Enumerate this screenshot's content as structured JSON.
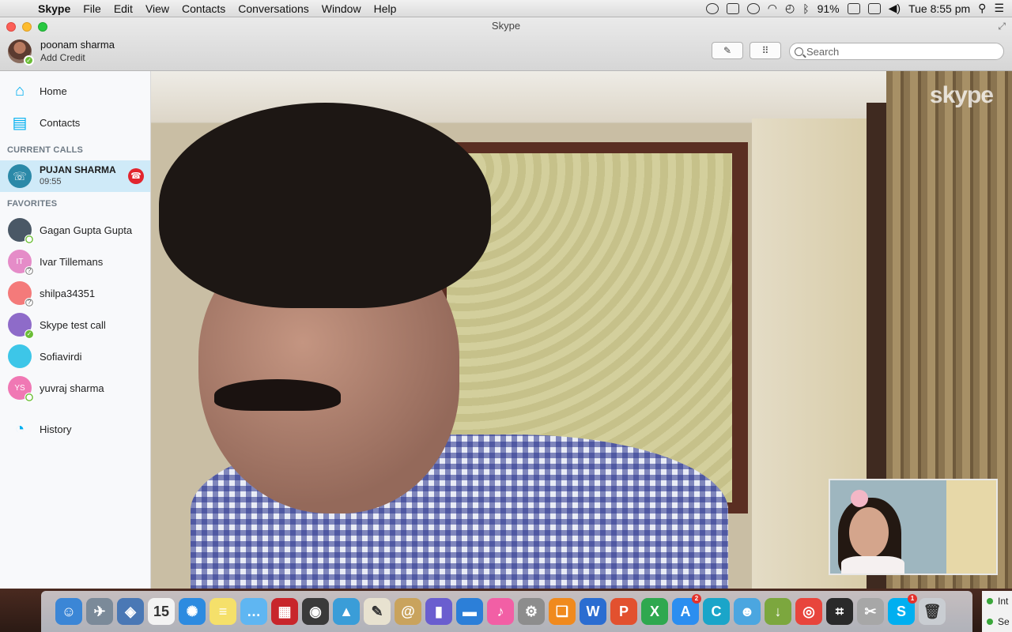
{
  "menubar": {
    "app": "Skype",
    "items": [
      "File",
      "Edit",
      "View",
      "Contacts",
      "Conversations",
      "Window",
      "Help"
    ],
    "battery": "91%",
    "clock": "Tue 8:55 pm"
  },
  "window": {
    "title": "Skype",
    "profile": {
      "name": "poonam sharma",
      "sub": "Add Credit"
    },
    "search_placeholder": "Search"
  },
  "sidebar": {
    "home": "Home",
    "contacts": "Contacts",
    "current_calls_header": "CURRENT CALLS",
    "call": {
      "name": "PUJAN SHARMA",
      "duration": "09:55"
    },
    "favorites_header": "FAVORITES",
    "favorites": [
      {
        "name": "Gagan Gupta Gupta",
        "initials": "",
        "color": "#4a5866",
        "status": "off"
      },
      {
        "name": "Ivar Tillemans",
        "initials": "IT",
        "color": "#e58cc8",
        "status": "unk"
      },
      {
        "name": "shilpa34351",
        "initials": "",
        "color": "#f47a7a",
        "status": "unk"
      },
      {
        "name": "Skype test call",
        "initials": "",
        "color": "#8e6bc9",
        "status": "on"
      },
      {
        "name": "Sofiavirdi",
        "initials": "",
        "color": "#3dc6e8",
        "status": "none"
      },
      {
        "name": "yuvraj sharma",
        "initials": "YS",
        "color": "#f078b4",
        "status": "off"
      }
    ],
    "history": "History"
  },
  "video": {
    "watermark": "skype"
  },
  "dock": {
    "apps": [
      {
        "name": "finder",
        "color": "#3b86d6",
        "glyph": "☺"
      },
      {
        "name": "launchpad",
        "color": "#7b8a99",
        "glyph": "✈"
      },
      {
        "name": "preview",
        "color": "#4a78b5",
        "glyph": "◈"
      },
      {
        "name": "calendar",
        "color": "#f3f3f3",
        "glyph": "15"
      },
      {
        "name": "safari",
        "color": "#2d8be0",
        "glyph": "✺"
      },
      {
        "name": "stickies",
        "color": "#f5e06a",
        "glyph": "≡"
      },
      {
        "name": "messages",
        "color": "#5fb6f2",
        "glyph": "…"
      },
      {
        "name": "photo-booth",
        "color": "#c8262b",
        "glyph": "▦"
      },
      {
        "name": "facetime",
        "color": "#3a3a3a",
        "glyph": "◉"
      },
      {
        "name": "iphoto",
        "color": "#3a9dd8",
        "glyph": "▲"
      },
      {
        "name": "textedit",
        "color": "#e8e2d0",
        "glyph": "✎"
      },
      {
        "name": "contacts",
        "color": "#c9a35d",
        "glyph": "@"
      },
      {
        "name": "keynote-stats",
        "color": "#6a5ecf",
        "glyph": "▮"
      },
      {
        "name": "keynote",
        "color": "#2c7fd8",
        "glyph": "▬"
      },
      {
        "name": "itunes",
        "color": "#f25fa5",
        "glyph": "♪"
      },
      {
        "name": "system-preferences",
        "color": "#8d8d8d",
        "glyph": "⚙"
      },
      {
        "name": "ibooks",
        "color": "#f08a1e",
        "glyph": "❏"
      },
      {
        "name": "word",
        "color": "#2b6dd1",
        "glyph": "W"
      },
      {
        "name": "powerpoint",
        "color": "#e2512f",
        "glyph": "P"
      },
      {
        "name": "excel",
        "color": "#2fa84f",
        "glyph": "X"
      },
      {
        "name": "app-store",
        "color": "#2b8ef0",
        "glyph": "A",
        "badge": "2"
      },
      {
        "name": "c-app",
        "color": "#1aa5c9",
        "glyph": "C"
      },
      {
        "name": "people-app",
        "color": "#4ba6e0",
        "glyph": "☻"
      },
      {
        "name": "downloader",
        "color": "#7ca73e",
        "glyph": "↓"
      },
      {
        "name": "chrome",
        "color": "#e8453c",
        "glyph": "◎"
      },
      {
        "name": "frame-app",
        "color": "#2a2a2a",
        "glyph": "⌗"
      },
      {
        "name": "utilities",
        "color": "#a7a7a7",
        "glyph": "✂"
      },
      {
        "name": "skype",
        "color": "#00aff0",
        "glyph": "S",
        "badge": "1"
      },
      {
        "name": "trash",
        "color": "#c9cdd2",
        "glyph": "🗑"
      }
    ]
  },
  "notification": {
    "line1": "Int",
    "line2": "Se"
  }
}
